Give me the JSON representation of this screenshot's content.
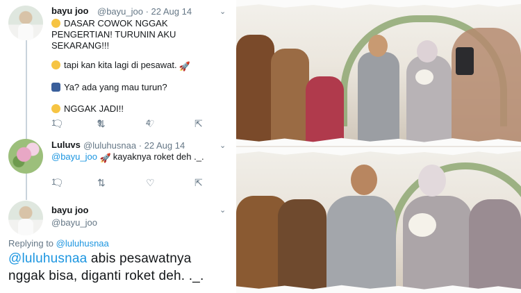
{
  "tweets": [
    {
      "name": "bayu joo",
      "handle": "@bayu_joo",
      "date": "22 Aug 14",
      "lines": [
        "DASAR COWOK NGGAK",
        "PENGERTIAN! TURUNIN AKU",
        "SEKARANG!!!"
      ],
      "line2": "tapi kan kita lagi di pesawat.",
      "line3": "Ya? ada yang mau turun?",
      "line4": "NGGAK JADI!!",
      "actions": {
        "replies": "1",
        "retweets": "9",
        "likes": "4"
      }
    },
    {
      "name": "Luluvs",
      "handle": "@luluhusnaa",
      "date": "22 Aug 14",
      "mention": "@bayu_joo",
      "text": "kayaknya roket deh ._.",
      "actions": {
        "replies": "1"
      }
    },
    {
      "name": "bayu joo",
      "handle": "@bayu_joo",
      "replying_label": "Replying to",
      "replying_to": "@luluhusnaa",
      "mention": "@luluhusnaa",
      "text_line1": "abis pesawatnya",
      "text_line2": "nggak bisa, diganti roket deh. ._."
    }
  ],
  "icons": [
    "reply-icon",
    "retweet-icon",
    "like-icon",
    "share-icon",
    "chevron-down-icon",
    "rocket-emoji"
  ],
  "colors": {
    "link": "#1b95e0",
    "text": "#14171a",
    "muted": "#657786"
  }
}
